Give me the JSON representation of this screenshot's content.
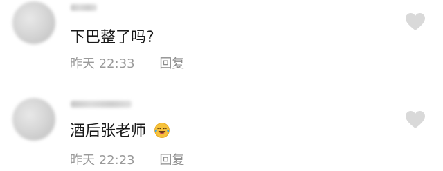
{
  "comments": [
    {
      "username": "▬▬▬",
      "text": "下巴整了吗?",
      "date_label": "昨天",
      "time": "22:33",
      "reply_label": "回复",
      "like_icon": "heart-outline-icon"
    },
    {
      "username": "▬▬▬▬▬▬",
      "text": "酒后张老师",
      "emoji": "laughing-crying-emoji",
      "date_label": "昨天",
      "time": "22:23",
      "reply_label": "回复",
      "like_icon": "heart-outline-icon"
    }
  ],
  "colors": {
    "text_primary": "#1a1a1a",
    "text_secondary": "#9a9a9a",
    "heart": "#d9d9d9",
    "emoji_face": "#f7c23b",
    "emoji_tears": "#3aa3e8"
  }
}
